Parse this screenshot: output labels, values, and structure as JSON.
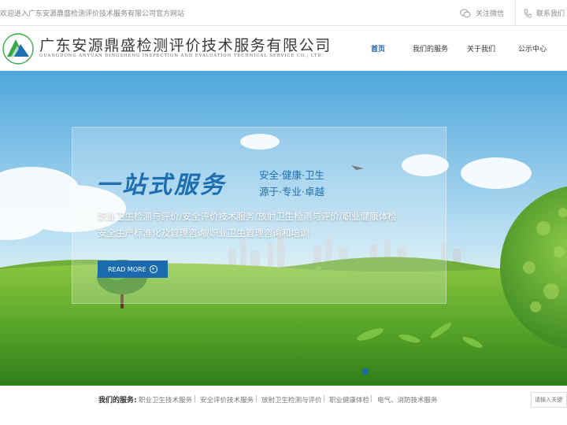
{
  "topbar": {
    "welcome": "欢迎进入广东安源鼎盛检测评价技术服务有限公司官方网站",
    "wechat": "关注微信",
    "contact": "联系我们"
  },
  "header": {
    "company_cn": "广东安源鼎盛检测评价技术服务有限公司",
    "company_en": "GUANGDONG ANYUAN DINGSHENG INSPECTION AND EVALUATION TECHNICAL SERVICE CO., LTD.",
    "nav": [
      {
        "label": "首页",
        "active": true
      },
      {
        "label": "我们的服务"
      },
      {
        "label": "关于我们"
      },
      {
        "label": "公示中心"
      }
    ]
  },
  "banner": {
    "slogan": "一站式服务",
    "tagline1": "安全·健康·卫生",
    "tagline2": "源于·专业·卓越",
    "desc1": "职业卫生检测与评价/安全评价技术服务/放射卫生检测与评价/职业健康体检",
    "desc2": "安全生产标准化及管理咨询/职业卫生管理咨询和培训",
    "read_more": "READ MORE",
    "arrow_icon": "arrow-right-icon"
  },
  "services_strip": {
    "label": "我们的服务:",
    "items": [
      "职业卫生技术服务",
      "安全评价技术服务",
      "放射卫生检测与评价",
      "职业健康体检",
      "电气、消防技术服务"
    ],
    "separator": "|",
    "search_placeholder": "请输入关键字"
  },
  "colors": {
    "brand_blue": "#1a6aad",
    "logo_green": "#3aa84a"
  }
}
